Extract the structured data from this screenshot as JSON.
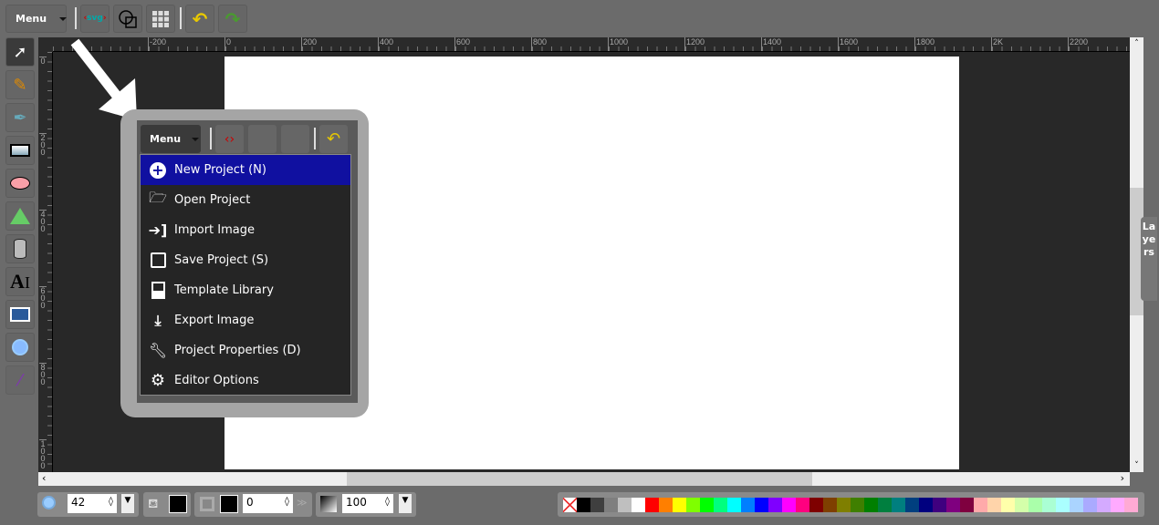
{
  "toolbar": {
    "menu_label": "Menu",
    "buttons": [
      "svg-source",
      "wireframe",
      "grid",
      "undo",
      "redo"
    ],
    "svg_icon_text": "svg"
  },
  "left_tools": [
    "select",
    "pencil",
    "path",
    "rectangle",
    "ellipse",
    "shape-library",
    "database",
    "text",
    "image",
    "zoom",
    "eyedropper"
  ],
  "rulers": {
    "horizontal": [
      "-200",
      "0",
      "200",
      "400",
      "600",
      "800",
      "1000",
      "1200",
      "1400",
      "1600",
      "1800",
      "2K",
      "2200"
    ],
    "vertical": [
      "0",
      "200",
      "400",
      "600",
      "800",
      "1000"
    ]
  },
  "layers_tab": "Layers",
  "menu": {
    "label": "Menu",
    "items": [
      {
        "label": "New Project (N)",
        "icon": "plus-circle",
        "highlighted": true
      },
      {
        "label": "Open Project",
        "icon": "folder-open"
      },
      {
        "label": "Import Image",
        "icon": "import"
      },
      {
        "label": "Save Project (S)",
        "icon": "floppy"
      },
      {
        "label": "Template Library",
        "icon": "image-file"
      },
      {
        "label": "Export Image",
        "icon": "download"
      },
      {
        "label": "Project Properties (D)",
        "icon": "wrench"
      },
      {
        "label": "Editor Options",
        "icon": "gear"
      }
    ],
    "highlight_color": "#1010a0"
  },
  "bottom": {
    "zoom": "42",
    "fill_color": "#000000",
    "stroke_color": "#000000",
    "stroke_width": "0",
    "opacity": "100"
  },
  "palette": [
    "none",
    "#000000",
    "#3f3f3f",
    "#7f7f7f",
    "#bfbfbf",
    "#ffffff",
    "#ff0000",
    "#ff7f00",
    "#ffff00",
    "#7fff00",
    "#00ff00",
    "#00ff7f",
    "#00ffff",
    "#007fff",
    "#0000ff",
    "#7f00ff",
    "#ff00ff",
    "#ff007f",
    "#7f0000",
    "#7f3f00",
    "#7f7f00",
    "#3f7f00",
    "#007f00",
    "#007f3f",
    "#007f7f",
    "#003f7f",
    "#00007f",
    "#3f007f",
    "#7f007f",
    "#7f003f",
    "#ffaaaa",
    "#ffd4aa",
    "#ffffaa",
    "#d4ffaa",
    "#aaffaa",
    "#aaffd4",
    "#aaffff",
    "#aad4ff",
    "#aaaaff",
    "#d4aaff",
    "#ffaaff",
    "#ffaad4"
  ]
}
